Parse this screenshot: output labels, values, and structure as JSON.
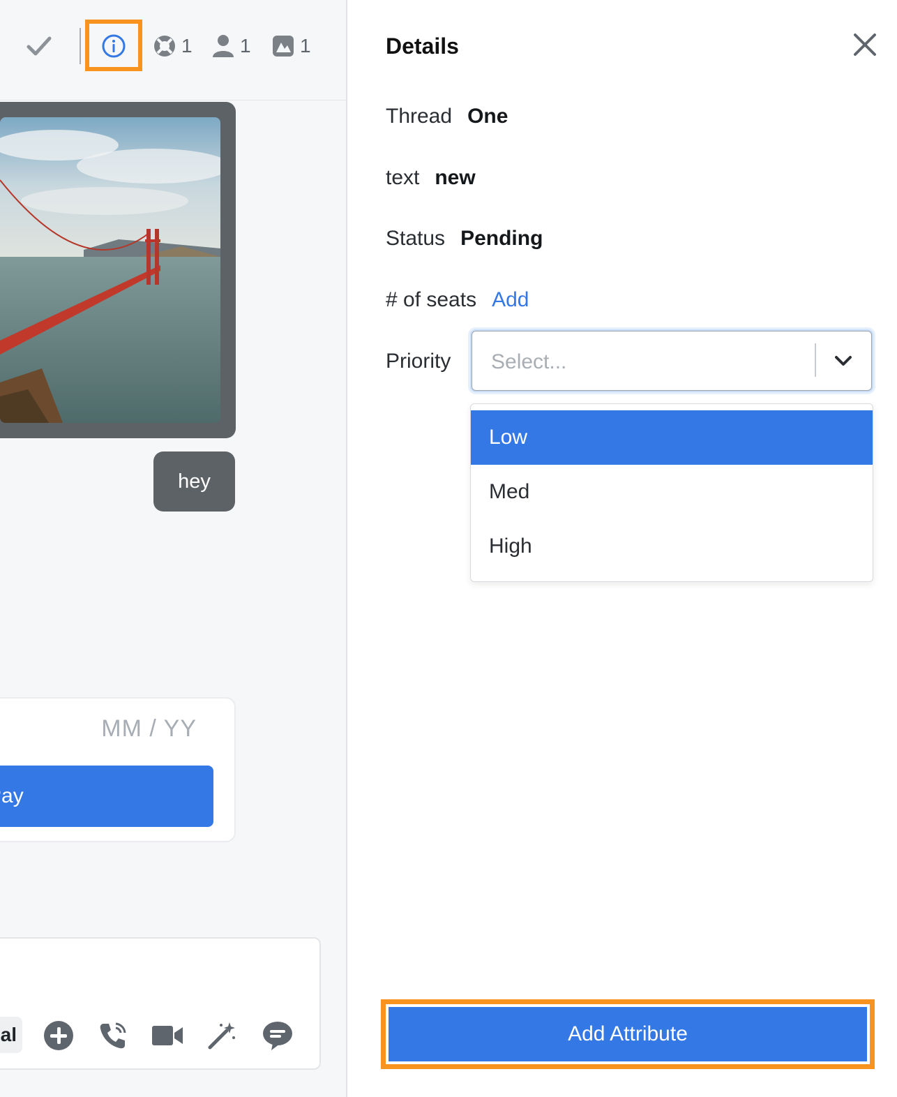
{
  "toolbar": {
    "resolve_icon": "checkmark-icon",
    "info_icon": "info-icon",
    "support_count": "1",
    "members_count": "1",
    "media_count": "1"
  },
  "chat": {
    "image_alt": "Golden Gate Bridge photo",
    "bubble_text": "hey",
    "payment": {
      "expiry_placeholder": "MM / YY",
      "pay_label": "Pay"
    },
    "composer": {
      "chip_label": "al",
      "icons": [
        "plus-circle-icon",
        "phone-icon",
        "video-icon",
        "magic-wand-icon",
        "chat-icon"
      ]
    }
  },
  "details": {
    "title": "Details",
    "rows": [
      {
        "label": "Thread",
        "value": "One"
      },
      {
        "label": "text",
        "value": "new"
      },
      {
        "label": "Status",
        "value": "Pending"
      }
    ],
    "seats": {
      "label": "# of seats",
      "action": "Add"
    },
    "priority": {
      "label": "Priority",
      "placeholder": "Select...",
      "options": [
        "Low",
        "Med",
        "High"
      ],
      "highlighted": "Low"
    },
    "add_attribute": "Add Attribute"
  },
  "colors": {
    "accent": "#3478e5",
    "highlight": "#f7931e",
    "bubble": "#5d6267"
  }
}
